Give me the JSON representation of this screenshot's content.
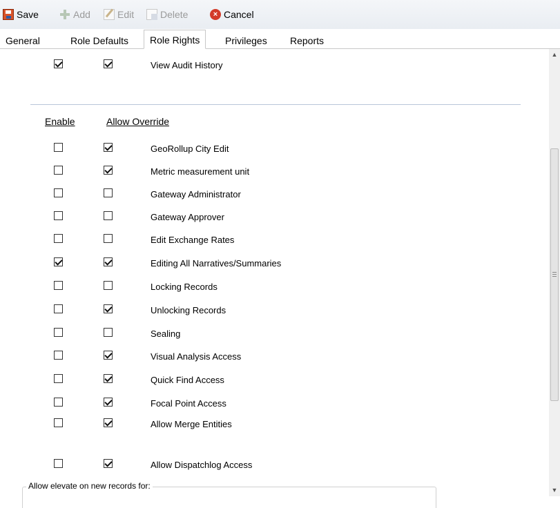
{
  "toolbar": {
    "save": "Save",
    "add": "Add",
    "edit": "Edit",
    "delete": "Delete",
    "cancel": "Cancel",
    "icons": {
      "save": "save-disk-icon",
      "add": "add-plus-icon",
      "edit": "edit-pencil-icon",
      "delete": "delete-icon",
      "cancel": "cancel-x-icon"
    }
  },
  "tabs": [
    {
      "label": "General",
      "active": false
    },
    {
      "label": "Role Defaults",
      "active": false
    },
    {
      "label": "Role Rights",
      "active": true
    },
    {
      "label": "Privileges",
      "active": false
    },
    {
      "label": "Reports",
      "active": false
    }
  ],
  "top_right": {
    "label": "View Audit History",
    "enable": true,
    "override": true
  },
  "columns": {
    "enable": "Enable",
    "allow_override": "Allow Override"
  },
  "rights": [
    {
      "label": "GeoRollup City Edit",
      "enable": false,
      "override": true
    },
    {
      "label": "Metric measurement unit",
      "enable": false,
      "override": true
    },
    {
      "label": "Gateway Administrator",
      "enable": false,
      "override": false
    },
    {
      "label": "Gateway Approver",
      "enable": false,
      "override": false
    },
    {
      "label": "Edit Exchange Rates",
      "enable": false,
      "override": false
    },
    {
      "label": "Editing All Narratives/Summaries",
      "enable": true,
      "override": true
    },
    {
      "label": "Locking Records",
      "enable": false,
      "override": false
    },
    {
      "label": "Unlocking Records",
      "enable": false,
      "override": true
    },
    {
      "label": "Sealing",
      "enable": false,
      "override": false
    },
    {
      "label": "Visual Analysis Access",
      "enable": false,
      "override": true
    },
    {
      "label": "Quick Find Access",
      "enable": false,
      "override": true
    },
    {
      "label": "Focal Point Access",
      "enable": false,
      "override": true
    },
    {
      "label": "Allow Merge Entities",
      "enable": false,
      "override": true
    },
    {
      "label": "Allow Dispatchlog Access",
      "enable": false,
      "override": true
    }
  ],
  "elevate_group": {
    "legend": "Allow elevate on new records for:"
  },
  "colors": {
    "toolbar_bg": "#eef1f5",
    "divider": "#b9c6d8",
    "cancel_red": "#d33b2a"
  }
}
